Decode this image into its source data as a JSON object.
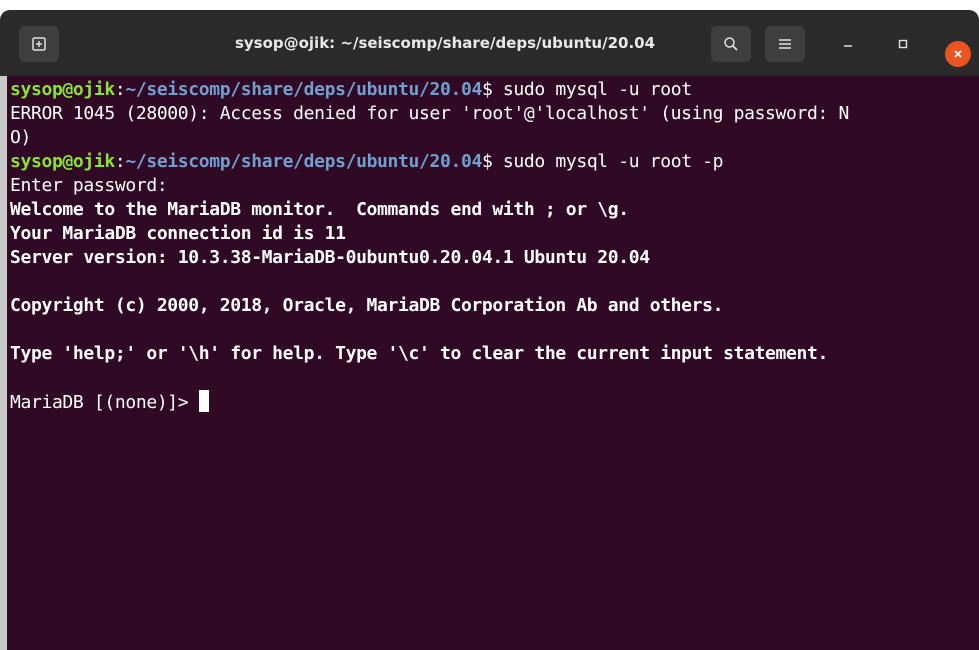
{
  "window": {
    "title": "sysop@ojik: ~/seiscomp/share/deps/ubuntu/20.04"
  },
  "icons": {
    "new_tab": "new-tab-icon",
    "search": "search-icon",
    "menu": "hamburger-menu-icon",
    "minimize": "minimize-icon",
    "maximize": "maximize-icon",
    "close": "close-icon"
  },
  "colors": {
    "terminal_bg": "#300a24",
    "prompt_user": "#8ae234",
    "prompt_path": "#729fcf",
    "close_button": "#e95420",
    "titlebar_bg": "#2b2b2b"
  },
  "terminal": {
    "prompt1": {
      "user": "sysop@ojik",
      "sep": ":",
      "path": "~/seiscomp/share/deps/ubuntu/20.04",
      "symbol": "$",
      "command": " sudo mysql -u root"
    },
    "error_line1": "ERROR 1045 (28000): Access denied for user 'root'@'localhost' (using password: N",
    "error_line2": "O)",
    "prompt2": {
      "user": "sysop@ojik",
      "sep": ":",
      "path": "~/seiscomp/share/deps/ubuntu/20.04",
      "symbol": "$",
      "command": " sudo mysql -u root -p"
    },
    "enter_password": "Enter password:",
    "welcome": "Welcome to the MariaDB monitor.  Commands end with ; or \\g.",
    "connection_id": "Your MariaDB connection id is 11",
    "server_version": "Server version: 10.3.38-MariaDB-0ubuntu0.20.04.1 Ubuntu 20.04",
    "copyright": "Copyright (c) 2000, 2018, Oracle, MariaDB Corporation Ab and others.",
    "help_text": "Type 'help;' or '\\h' for help. Type '\\c' to clear the current input statement.",
    "maria_prompt": "MariaDB [(none)]> "
  }
}
